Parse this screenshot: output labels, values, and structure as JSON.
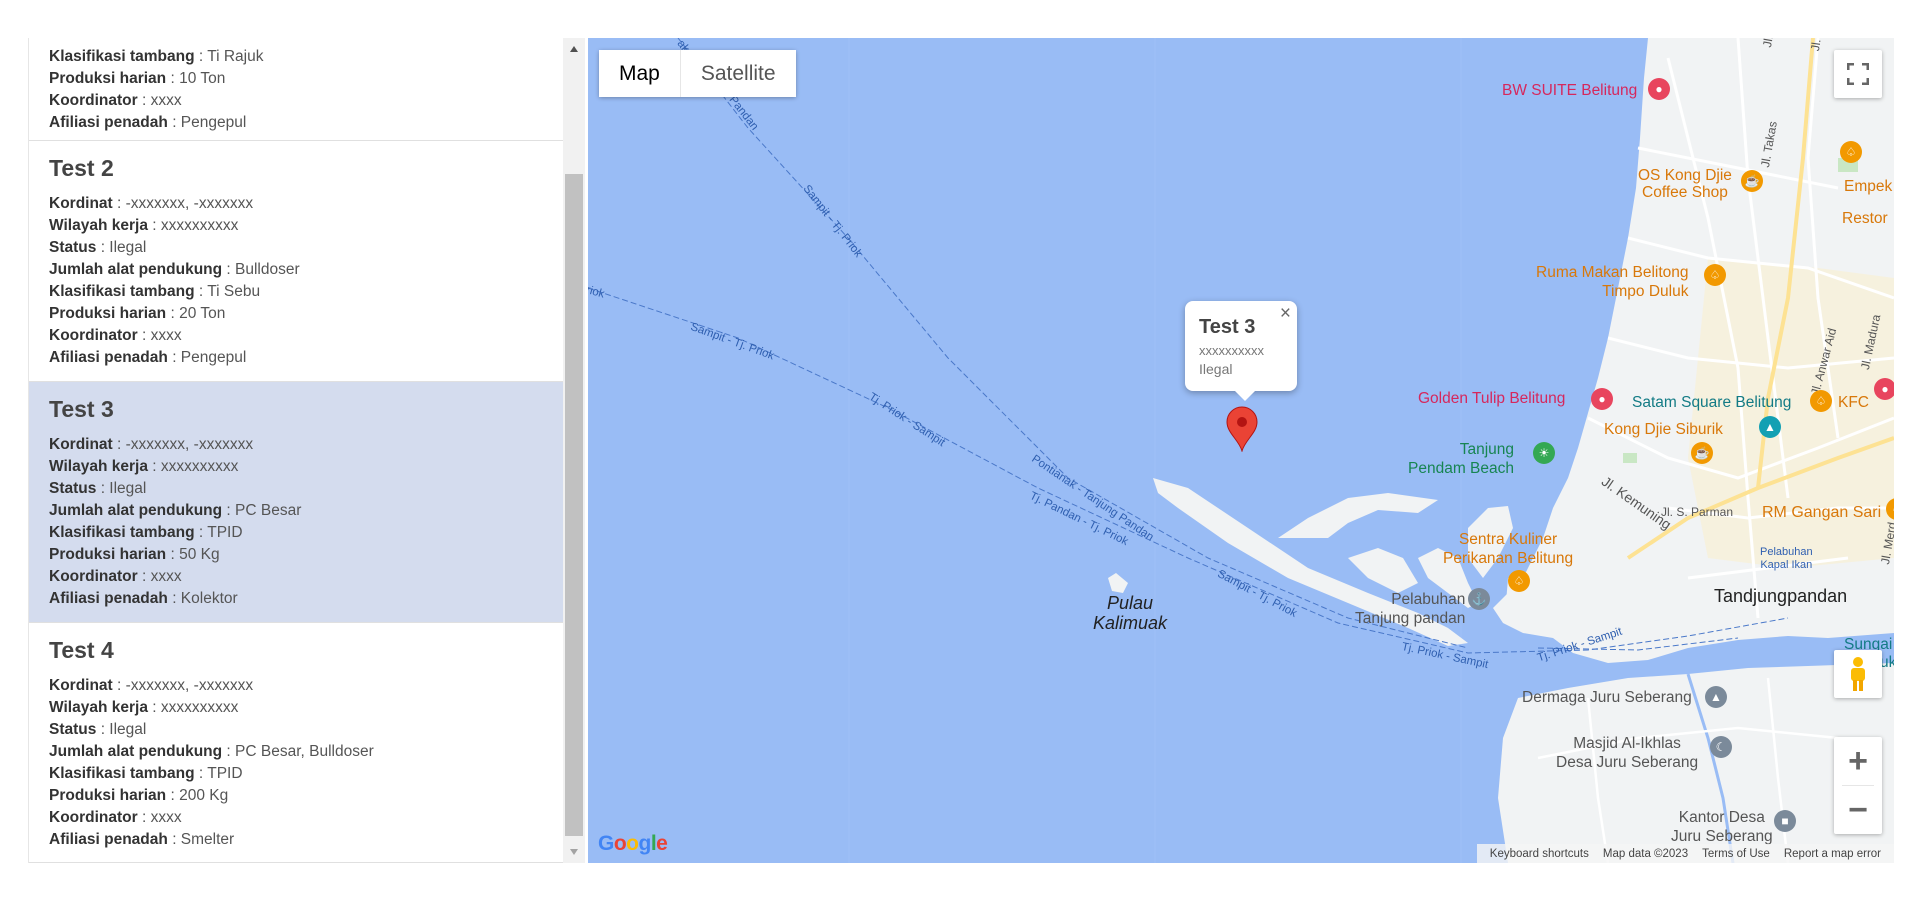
{
  "list": {
    "partial_card": {
      "fields": [
        {
          "label": "Klasifikasi tambang",
          "value": ": Ti Rajuk"
        },
        {
          "label": "Produksi harian",
          "value": ": 10 Ton"
        },
        {
          "label": "Koordinator",
          "value": ": xxxx"
        },
        {
          "label": "Afiliasi penadah",
          "value": ": Pengepul"
        }
      ]
    },
    "cards": [
      {
        "title": "Test 2",
        "fields": [
          {
            "label": "Kordinat",
            "value": ": -xxxxxxx, -xxxxxxx"
          },
          {
            "label": "Wilayah kerja",
            "value": ": xxxxxxxxxx"
          },
          {
            "label": "Status",
            "value": ": Ilegal"
          },
          {
            "label": "Jumlah alat pendukung",
            "value": ": Bulldoser"
          },
          {
            "label": "Klasifikasi tambang",
            "value": ": Ti Sebu"
          },
          {
            "label": "Produksi harian",
            "value": ": 20 Ton"
          },
          {
            "label": "Koordinator",
            "value": ": xxxx"
          },
          {
            "label": "Afiliasi penadah",
            "value": ": Pengepul"
          }
        ]
      },
      {
        "title": "Test 3",
        "fields": [
          {
            "label": "Kordinat",
            "value": ": -xxxxxxx, -xxxxxxx"
          },
          {
            "label": "Wilayah kerja",
            "value": ": xxxxxxxxxx"
          },
          {
            "label": "Status",
            "value": ": Ilegal"
          },
          {
            "label": "Jumlah alat pendukung",
            "value": ": PC Besar"
          },
          {
            "label": "Klasifikasi tambang",
            "value": ": TPID"
          },
          {
            "label": "Produksi harian",
            "value": ": 50 Kg"
          },
          {
            "label": "Koordinator",
            "value": ": xxxx"
          },
          {
            "label": "Afiliasi penadah",
            "value": ": Kolektor"
          }
        ]
      },
      {
        "title": "Test 4",
        "fields": [
          {
            "label": "Kordinat",
            "value": ": -xxxxxxx, -xxxxxxx"
          },
          {
            "label": "Wilayah kerja",
            "value": ": xxxxxxxxxx"
          },
          {
            "label": "Status",
            "value": ": Ilegal"
          },
          {
            "label": "Jumlah alat pendukung",
            "value": ": PC Besar, Bulldoser"
          },
          {
            "label": "Klasifikasi tambang",
            "value": ": TPID"
          },
          {
            "label": "Produksi harian",
            "value": ": 200 Kg"
          },
          {
            "label": "Koordinator",
            "value": ": xxxx"
          },
          {
            "label": "Afiliasi penadah",
            "value": ": Smelter"
          }
        ]
      }
    ],
    "selected_index": 1,
    "selected_color": "#d4dcee"
  },
  "map": {
    "type_buttons": {
      "map": "Map",
      "satellite": "Satellite"
    },
    "active_type": "Map",
    "water_color": "#99bcf5",
    "land_color": "#f1f3f4",
    "infowindow": {
      "title": "Test 3",
      "line1": "xxxxxxxxxx",
      "line2": "Ilegal",
      "close": "×"
    },
    "marker_color": "#ea4335",
    "labels": {
      "bw_suite": "BW SUITE Belitung",
      "os_kong": "OS Kong Djie",
      "coffee_shop": "Coffee Shop",
      "empek": "Empek",
      "restor": "Restor",
      "ruma_makan": "Ruma Makan Belitong",
      "timpo_duluk": "Timpo Duluk",
      "golden_tulip": "Golden Tulip Belitung",
      "satam_square": "Satam Square Belitung",
      "kfc": "KFC",
      "kong_djie_siburik": "Kong Djie Siburik",
      "tanjung": "Tanjung",
      "pendam_beach": "Pendam Beach",
      "rm_gangan": "RM Gangan Sari",
      "sentra1": "Sentra Kuliner",
      "sentra2": "Perikanan Belitung",
      "pelabuhan1": "Pelabuhan",
      "pelabuhan2": "Tanjung pandan",
      "tandjungpandan": "Tandjungpandan",
      "pelabuhan_kapal1": "Pelabuhan",
      "pelabuhan_kapal2": "Kapal Ikan",
      "sungai": "Sungai",
      "sungai_suffix": "uk",
      "dermaga": "Dermaga Juru Seberang",
      "masjid1": "Masjid Al-Ikhlas",
      "masjid2": "Desa Juru Seberang",
      "kantor1": "Kantor Desa",
      "kantor2": "Juru Seberang",
      "pulau1": "Pulau",
      "pulau2": "Kalimuak",
      "jl_kemuning": "Jl. Kemuning",
      "jl_s_parman": "Jl. S. Parman",
      "jl_z_a_p": "Jl. Z. A. P.",
      "jl_lettu": "Jl. Lettu",
      "jl_takas": "Jl. Takas",
      "jl_anwar_aid": "Jl. Anwar Aid",
      "jl_madura": "Jl. Madura",
      "jl_merd": "Jl. Merd",
      "route_sampit_tj_priok_1": "Sampit - Tj. Priok",
      "route_sampit_tj_priok_2": "Sampit - Tj. Priok",
      "route_sampit_tj_priok_3": "Sampit - Tj. Priok",
      "route_tj_priok_sampit_1": "Tj. Priok - Sampit",
      "route_tj_priok_sampit_2": "Tj. Priok - Sampit",
      "route_tj_priok_sampit_3": "Tj. Priok - Sampit",
      "route_pontianak": "Pontianak - Tanjung Pandan",
      "route_tj_pandan_priok": "Tj. Pandan - Tj. Priok",
      "route_pandan": "Pandan",
      "route_ak": "ak",
      "route_riok": "riok"
    },
    "google_logo": "Google",
    "attribution": {
      "keyboard": "Keyboard shortcuts",
      "map_data": "Map data ©2023",
      "terms": "Terms of Use",
      "report": "Report a map error"
    },
    "zoom": {
      "in": "+",
      "out": "−"
    }
  }
}
